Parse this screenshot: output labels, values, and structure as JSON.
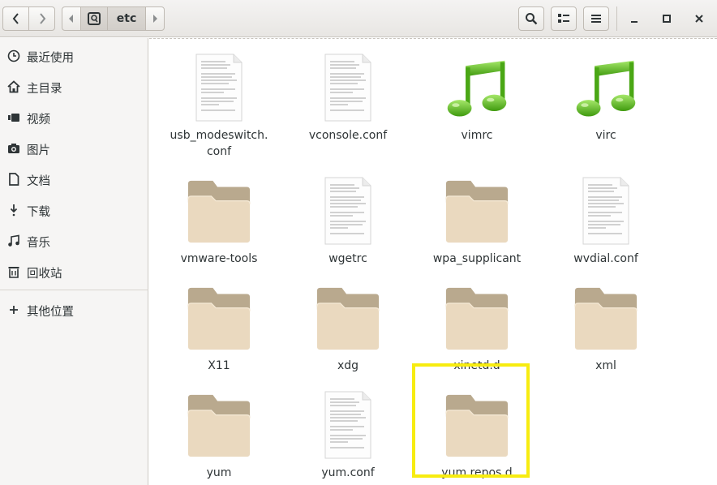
{
  "header": {
    "path_current": "etc",
    "icons": {
      "back": "go-previous-icon",
      "forward": "go-next-icon",
      "path_left": "pathbar-left-arrow-icon",
      "path_root": "root-drive-icon",
      "path_right": "pathbar-right-arrow-icon",
      "search": "search-icon",
      "view": "list-view-icon",
      "menu": "hamburger-menu-icon",
      "minimize": "minimize-icon",
      "maximize": "maximize-icon",
      "close": "close-icon"
    }
  },
  "sidebar": {
    "items": [
      {
        "label": "最近使用",
        "icon": "clock-icon"
      },
      {
        "label": "主目录",
        "icon": "home-icon"
      },
      {
        "label": "视频",
        "icon": "video-icon"
      },
      {
        "label": "图片",
        "icon": "camera-icon"
      },
      {
        "label": "文档",
        "icon": "document-icon"
      },
      {
        "label": "下载",
        "icon": "download-icon"
      },
      {
        "label": "音乐",
        "icon": "music-icon"
      },
      {
        "label": "回收站",
        "icon": "trash-icon"
      },
      {
        "label": "其他位置",
        "icon": "plus-icon"
      }
    ]
  },
  "files": [
    {
      "name_line1": "usb_modeswitch.",
      "name_line2": "conf",
      "type": "text"
    },
    {
      "name_line1": "vconsole.conf",
      "name_line2": "",
      "type": "text"
    },
    {
      "name_line1": "vimrc",
      "name_line2": "",
      "type": "audio"
    },
    {
      "name_line1": "virc",
      "name_line2": "",
      "type": "audio"
    },
    {
      "name_line1": "vmware-tools",
      "name_line2": "",
      "type": "folder"
    },
    {
      "name_line1": "wgetrc",
      "name_line2": "",
      "type": "text"
    },
    {
      "name_line1": "wpa_supplicant",
      "name_line2": "",
      "type": "folder"
    },
    {
      "name_line1": "wvdial.conf",
      "name_line2": "",
      "type": "text"
    },
    {
      "name_line1": "X11",
      "name_line2": "",
      "type": "folder"
    },
    {
      "name_line1": "xdg",
      "name_line2": "",
      "type": "folder"
    },
    {
      "name_line1": "xinetd.d",
      "name_line2": "",
      "type": "folder"
    },
    {
      "name_line1": "xml",
      "name_line2": "",
      "type": "folder"
    },
    {
      "name_line1": "yum",
      "name_line2": "",
      "type": "folder"
    },
    {
      "name_line1": "yum.conf",
      "name_line2": "",
      "type": "text"
    },
    {
      "name_line1": "yum.repos.d",
      "name_line2": "",
      "type": "folder",
      "highlighted": true
    }
  ],
  "colors": {
    "highlight": "#f7ec10",
    "folder_body": "#ead9bf",
    "folder_back": "#b9a98e",
    "note_green": "#5fc21c"
  }
}
